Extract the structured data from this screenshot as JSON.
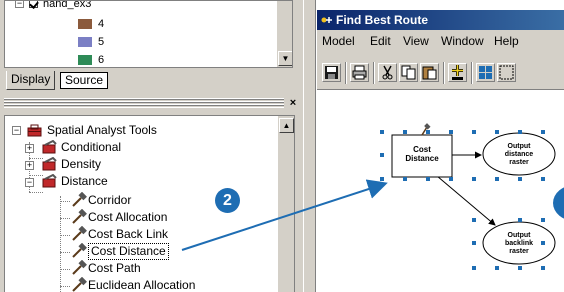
{
  "toc": {
    "layer_name": "hand_ex3",
    "classes": [
      {
        "label": "4",
        "color": "#8b5a3c"
      },
      {
        "label": "5",
        "color": "#7b7fc4"
      },
      {
        "label": "6",
        "color": "#2e8b57"
      }
    ],
    "tabs": [
      {
        "label": "Display"
      },
      {
        "label": "Source"
      }
    ]
  },
  "toolbox": {
    "root_label": "Spatial Analyst Tools",
    "toolsets": [
      {
        "label": "Conditional"
      },
      {
        "label": "Density"
      },
      {
        "label": "Distance"
      }
    ],
    "tools": [
      {
        "label": "Corridor"
      },
      {
        "label": "Cost Allocation"
      },
      {
        "label": "Cost Back Link"
      },
      {
        "label": "Cost Distance"
      },
      {
        "label": "Cost Path"
      },
      {
        "label": "Euclidean Allocation"
      }
    ],
    "close_glyph": "×"
  },
  "callout": {
    "number": "2",
    "color": "#1e6db3"
  },
  "model_window": {
    "title": "Find Best Route",
    "menus": [
      {
        "label": "Model"
      },
      {
        "label": "Edit"
      },
      {
        "label": "View"
      },
      {
        "label": "Window"
      },
      {
        "label": "Help"
      }
    ],
    "toolbar_icons": [
      "save-icon",
      "print-icon",
      "cut-icon",
      "copy-icon",
      "paste-icon",
      "add-data-icon",
      "grid-icon",
      "frame-icon"
    ],
    "nodes": {
      "tool_line1": "Cost",
      "tool_line2": "Distance",
      "out1_line1": "Output",
      "out1_line2": "distance",
      "out1_line3": "raster",
      "out2_line1": "Output",
      "out2_line2": "backlink",
      "out2_line3": "raster"
    }
  },
  "colors": {
    "title_bar": "#0a246a",
    "panel": "#d4d0c8",
    "arrow": "#1e6db3",
    "selection_handles": "#1e6db3",
    "toolbox_red": "#c0282a"
  }
}
